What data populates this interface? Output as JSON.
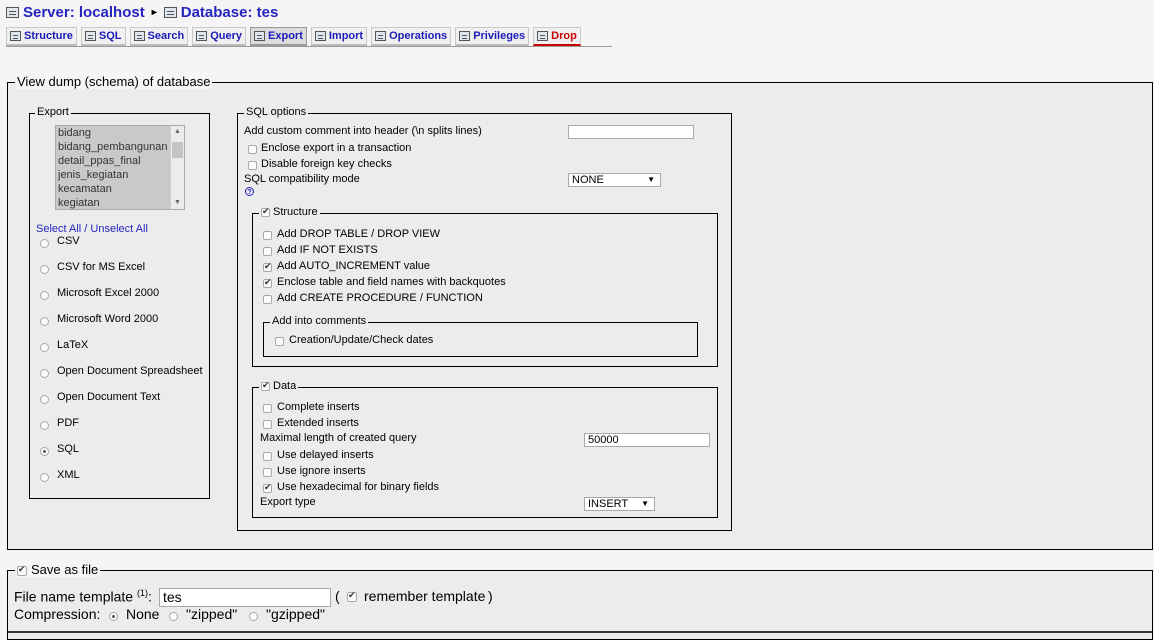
{
  "breadcrumb": {
    "server": "Server: localhost",
    "database": "Database: tes",
    "separator": "▸"
  },
  "tabs": [
    {
      "label": "Structure",
      "icon": "structure-icon"
    },
    {
      "label": "SQL",
      "icon": "sql-icon"
    },
    {
      "label": "Search",
      "icon": "search-icon"
    },
    {
      "label": "Query",
      "icon": "query-icon"
    },
    {
      "label": "Export",
      "icon": "export-icon",
      "active": true
    },
    {
      "label": "Import",
      "icon": "import-icon"
    },
    {
      "label": "Operations",
      "icon": "operations-icon"
    },
    {
      "label": "Privileges",
      "icon": "privileges-icon"
    },
    {
      "label": "Drop",
      "icon": "drop-icon"
    }
  ],
  "main_legend": "View dump (schema) of database",
  "export": {
    "legend": "Export",
    "tables": [
      "bidang",
      "bidang_pembangunan",
      "detail_ppas_final",
      "jenis_kegiatan",
      "kecamatan",
      "kegiatan"
    ],
    "select_all": "Select All",
    "slash": " / ",
    "unselect_all": "Unselect All",
    "formats": [
      {
        "label": "CSV",
        "checked": false
      },
      {
        "label": "CSV for MS Excel",
        "checked": false
      },
      {
        "label": "Microsoft Excel 2000",
        "checked": false
      },
      {
        "label": "Microsoft Word 2000",
        "checked": false
      },
      {
        "label": "LaTeX",
        "checked": false
      },
      {
        "label": "Open Document Spreadsheet",
        "checked": false
      },
      {
        "label": "Open Document Text",
        "checked": false
      },
      {
        "label": "PDF",
        "checked": false
      },
      {
        "label": "SQL",
        "checked": true
      },
      {
        "label": "XML",
        "checked": false
      }
    ]
  },
  "sql_options": {
    "legend": "SQL options",
    "comment_label": "Add custom comment into header (\\n splits lines)",
    "comment_value": "",
    "enclose_transaction": "Enclose export in a transaction",
    "disable_fk": "Disable foreign key checks",
    "compat_label": "SQL compatibility mode",
    "compat_value": "NONE",
    "help": "?",
    "structure": {
      "legend": "Structure",
      "options": [
        {
          "label": "Add DROP TABLE / DROP VIEW",
          "checked": false
        },
        {
          "label": "Add IF NOT EXISTS",
          "checked": false
        },
        {
          "label": "Add AUTO_INCREMENT value",
          "checked": true
        },
        {
          "label": "Enclose table and field names with backquotes",
          "checked": true
        },
        {
          "label": "Add CREATE PROCEDURE / FUNCTION",
          "checked": false
        }
      ],
      "comments_legend": "Add into comments",
      "comments_option": "Creation/Update/Check dates"
    },
    "data": {
      "legend": "Data",
      "complete_inserts": "Complete inserts",
      "extended_inserts": "Extended inserts",
      "max_query_label": "Maximal length of created query",
      "max_query_value": "50000",
      "delayed_inserts": "Use delayed inserts",
      "ignore_inserts": "Use ignore inserts",
      "hex_binary": "Use hexadecimal for binary fields",
      "export_type_label": "Export type",
      "export_type_value": "INSERT"
    }
  },
  "save": {
    "legend": "Save as file",
    "template_label": "File name template",
    "template_sup": "(1)",
    "template_colon": ":",
    "template_value": "tes",
    "open_paren": "(",
    "remember": "remember template",
    "close_paren": ")",
    "compression_label": "Compression:",
    "none": "None",
    "zipped": "\"zipped\"",
    "gzipped": "\"gzipped\""
  }
}
